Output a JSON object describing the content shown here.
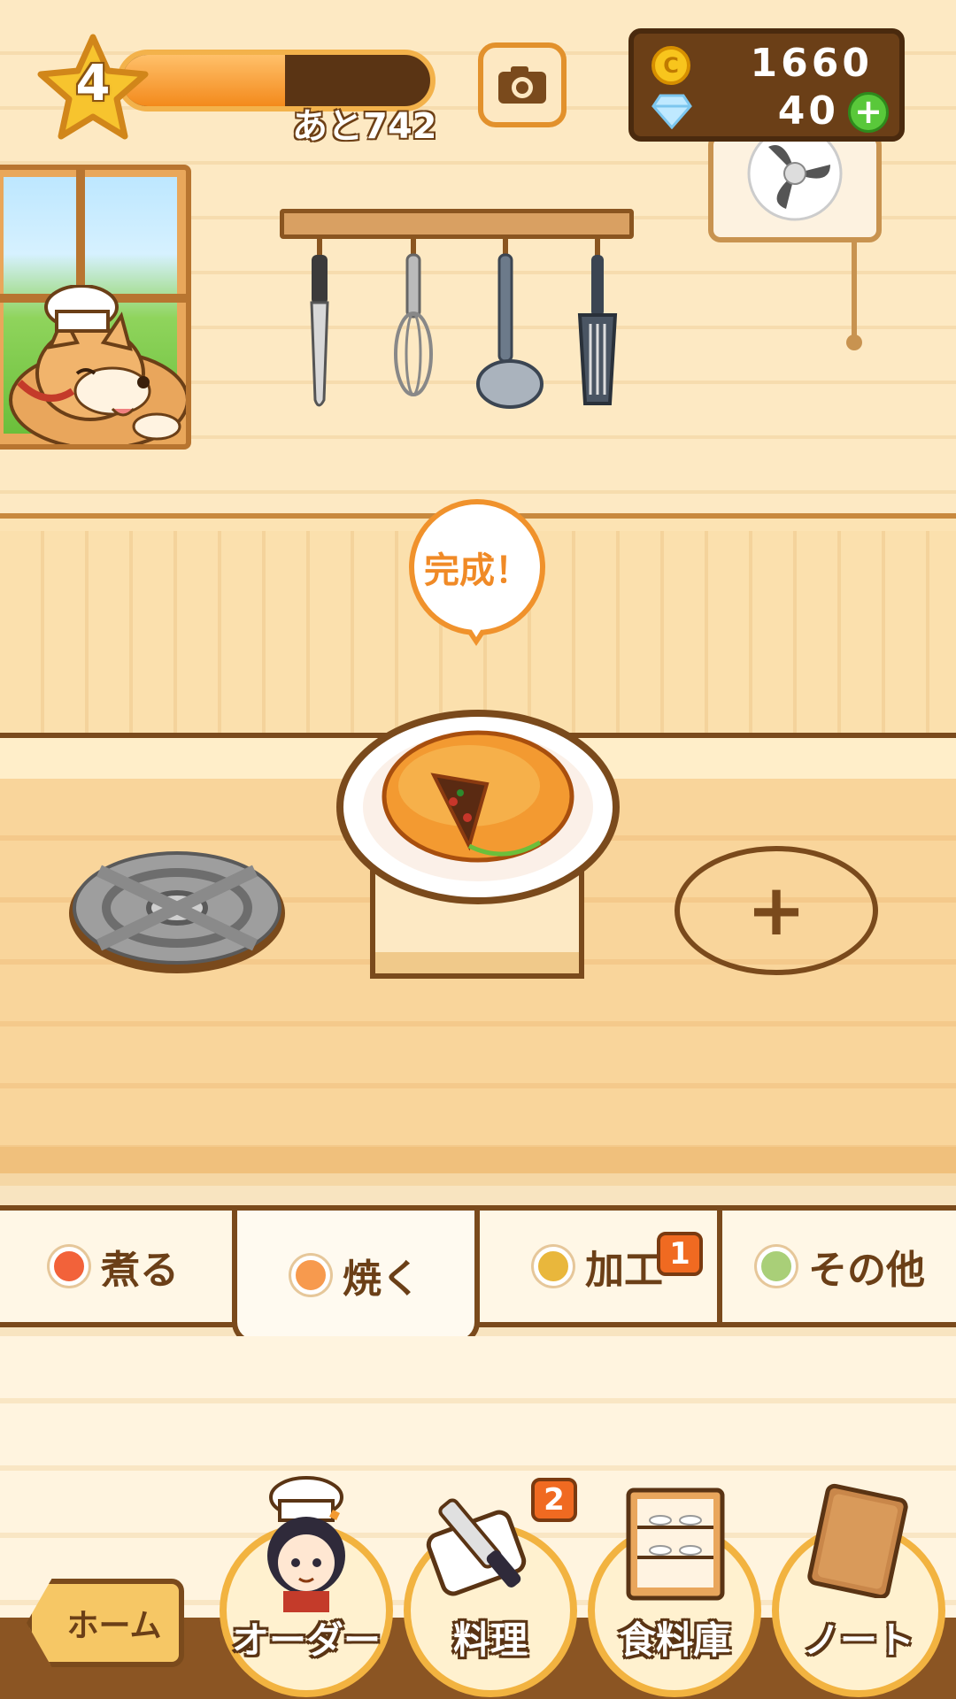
{
  "hud": {
    "level": "4",
    "xp_progress": 0.53,
    "xp_remaining": "あと742",
    "coins": "1660",
    "gems": "40",
    "coin_symbol": "C"
  },
  "kitchen": {
    "bubble_text": "完成！",
    "add_slot_label": "+"
  },
  "tabs": [
    {
      "label": "煮る",
      "dot_color": "#f2623a"
    },
    {
      "label": "焼く",
      "dot_color": "#f79a4e"
    },
    {
      "label": "加工",
      "dot_color": "#e9b73c",
      "badge": "1"
    },
    {
      "label": "その他",
      "dot_color": "#a9cf78"
    }
  ],
  "nav": {
    "home_label": "ホーム",
    "items": [
      {
        "label": "オーダー"
      },
      {
        "label": "料理",
        "badge": "2"
      },
      {
        "label": "食料庫"
      },
      {
        "label": "ノート"
      }
    ]
  },
  "colors": {
    "accent_orange": "#f08a26",
    "wood_brown": "#7a4a1c",
    "badge_orange": "#f06a21"
  }
}
